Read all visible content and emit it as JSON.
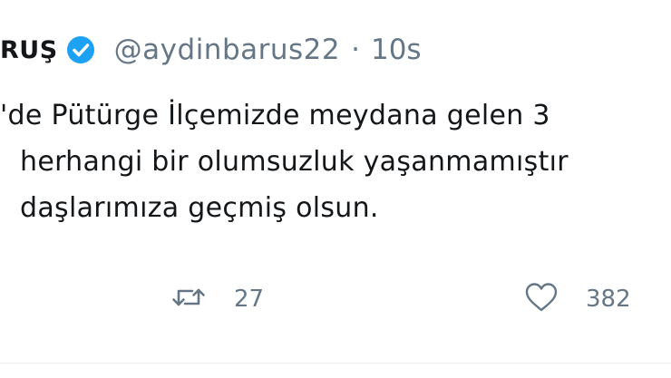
{
  "tweet": {
    "author_name": "RUŞ",
    "handle": "@aydinbarus22",
    "separator": "·",
    "time": "10s",
    "text_lines": [
      "'de Pütürge İlçemizde meydana gelen 3",
      "herhangi bir olumsuzluk yaşanmamıştır",
      "daşlarımıza geçmiş olsun."
    ],
    "retweet_count": "27",
    "like_count": "382"
  },
  "icons": {
    "verified": "verified-badge-icon",
    "retweet": "retweet-icon",
    "like": "heart-icon"
  },
  "colors": {
    "verified_blue": "#1da1f2",
    "secondary_text": "#657786",
    "primary_text": "#14171a"
  }
}
